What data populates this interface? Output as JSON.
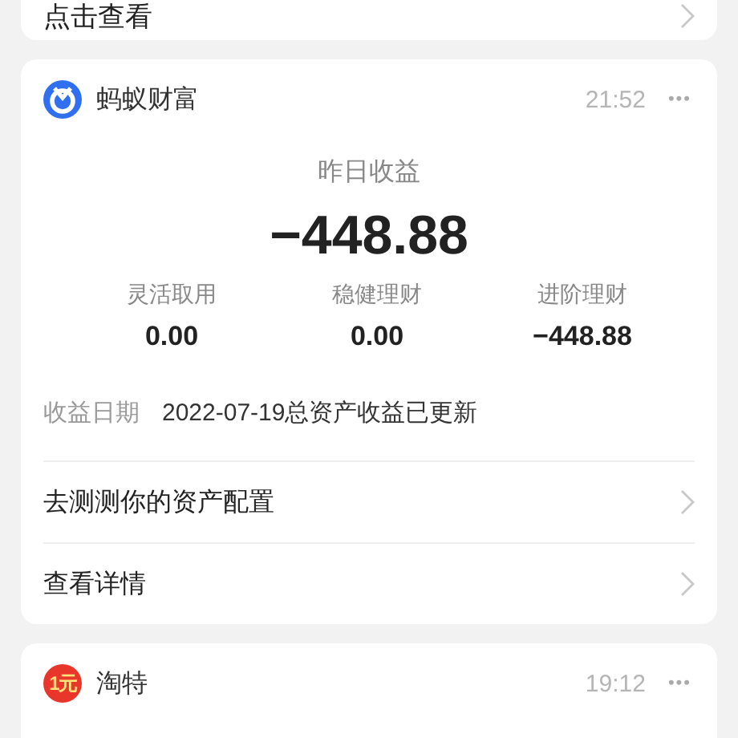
{
  "top_card": {
    "link": "点击查看"
  },
  "wealth_card": {
    "app_name": "蚂蚁财富",
    "time": "21:52",
    "more": "•••",
    "headline_label": "昨日收益",
    "headline_value": "−448.88",
    "stats": [
      {
        "label": "灵活取用",
        "value": "0.00"
      },
      {
        "label": "稳健理财",
        "value": "0.00"
      },
      {
        "label": "进阶理财",
        "value": "−448.88"
      }
    ],
    "date_label": "收益日期",
    "date_text": "2022-07-19总资产收益已更新",
    "actions": [
      "去测测你的资产配置",
      "查看详情"
    ]
  },
  "next_card": {
    "badge": "1元",
    "app_name": "淘特",
    "time": "19:12",
    "more": "•••"
  }
}
